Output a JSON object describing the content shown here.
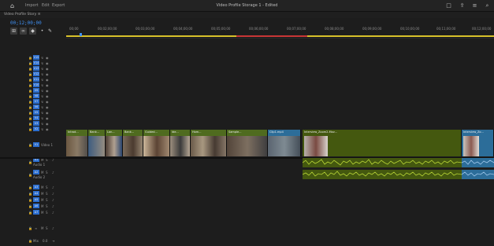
{
  "topbar": {
    "home_icon": "home-icon",
    "menu": [
      "Import",
      "Edit",
      "Export"
    ],
    "title": "Video Profile Storage 1 - Edited",
    "right_icons": [
      "window-icon",
      "share-icon",
      "menu-icon",
      "search-icon"
    ]
  },
  "sequence": {
    "tab_name": "Video Profile Story ≡",
    "timecode": "00;12;00;00"
  },
  "tools": [
    "snap-icon",
    "link-icon",
    "marker-icon",
    "cursor-icon",
    "wrench-icon"
  ],
  "ruler": {
    "labels": [
      "00;00",
      "00;02;00;00",
      "00;03;00;00",
      "00;04;00;00",
      "00;05;00;00",
      "00;06;00;00",
      "00;07;00;00",
      "00;08;00;00",
      "00;09;00;00",
      "00;10;00;00",
      "00;11;00;00",
      "00;12;00;00"
    ]
  },
  "video_tracks": [
    "V15",
    "V14",
    "V13",
    "V12",
    "V11",
    "V10",
    "V9",
    "V8",
    "V7",
    "V6",
    "V5",
    "V4",
    "V3",
    "V2"
  ],
  "v1": {
    "tag": "V1",
    "name": "Video 1"
  },
  "audio": {
    "a1": {
      "tag": "A1",
      "name": "Audio 1"
    },
    "a2": {
      "tag": "A2",
      "name": "Audio 2"
    },
    "tracks": [
      "A3",
      "A4",
      "A5",
      "A6",
      "A7"
    ],
    "mix": {
      "tag": "Mix",
      "value": "0.0"
    }
  },
  "clips": [
    {
      "name": "Introd..."
    },
    {
      "name": "Bank..."
    },
    {
      "name": "Lan..."
    },
    {
      "name": "Bank..."
    },
    {
      "name": "Guided..."
    },
    {
      "name": "Ide..."
    },
    {
      "name": "Hom..."
    },
    {
      "name": "Sample..."
    },
    {
      "name": "Clip1.mp4"
    },
    {
      "name": "Interview_Zoom2-Mov..."
    },
    {
      "name": "Interview_Zo..."
    }
  ],
  "colors": {
    "accent": "#3f8ff0",
    "video_clip": "#4f6b1f",
    "audio_clip": "#44580f",
    "selected_clip": "#2c6d99"
  }
}
